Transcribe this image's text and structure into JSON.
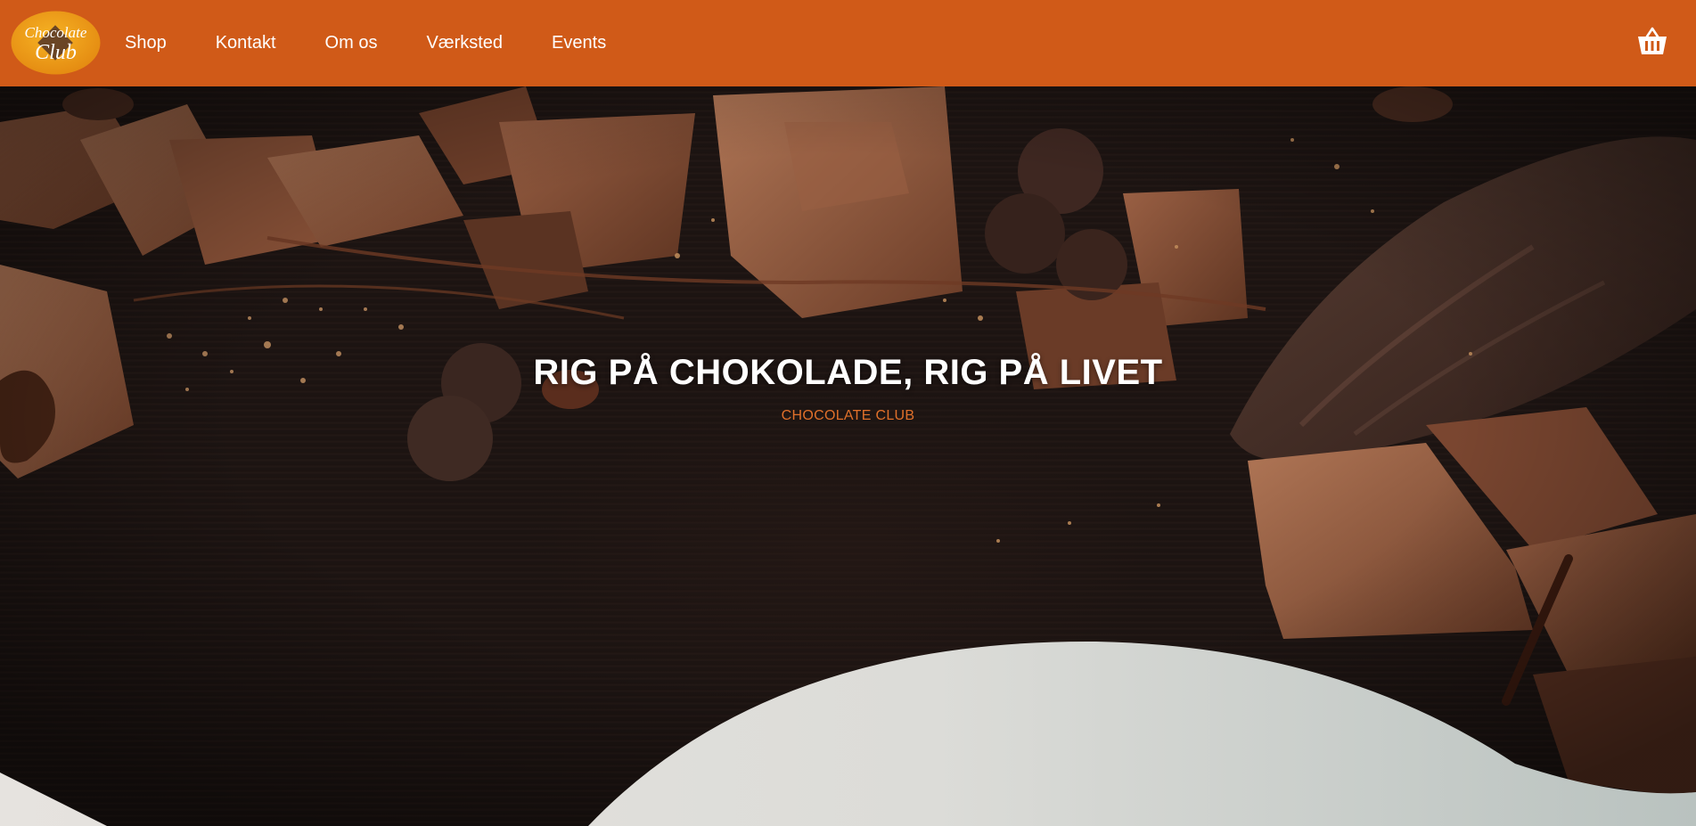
{
  "header": {
    "logo": {
      "line1": "Chocolate",
      "line2": "Club"
    },
    "nav": [
      {
        "label": "Shop"
      },
      {
        "label": "Kontakt"
      },
      {
        "label": "Om os"
      },
      {
        "label": "Værksted"
      },
      {
        "label": "Events"
      }
    ],
    "cart_icon": "basket-icon"
  },
  "hero": {
    "title": "RIG PÅ CHOKOLADE, RIG PÅ LIVET",
    "subtitle": "CHOCOLATE CLUB"
  },
  "colors": {
    "brand_orange": "#d05a18",
    "accent_text": "#e0702a",
    "hero_dark": "#1c1412",
    "wave_light": "#d9dcd8"
  }
}
